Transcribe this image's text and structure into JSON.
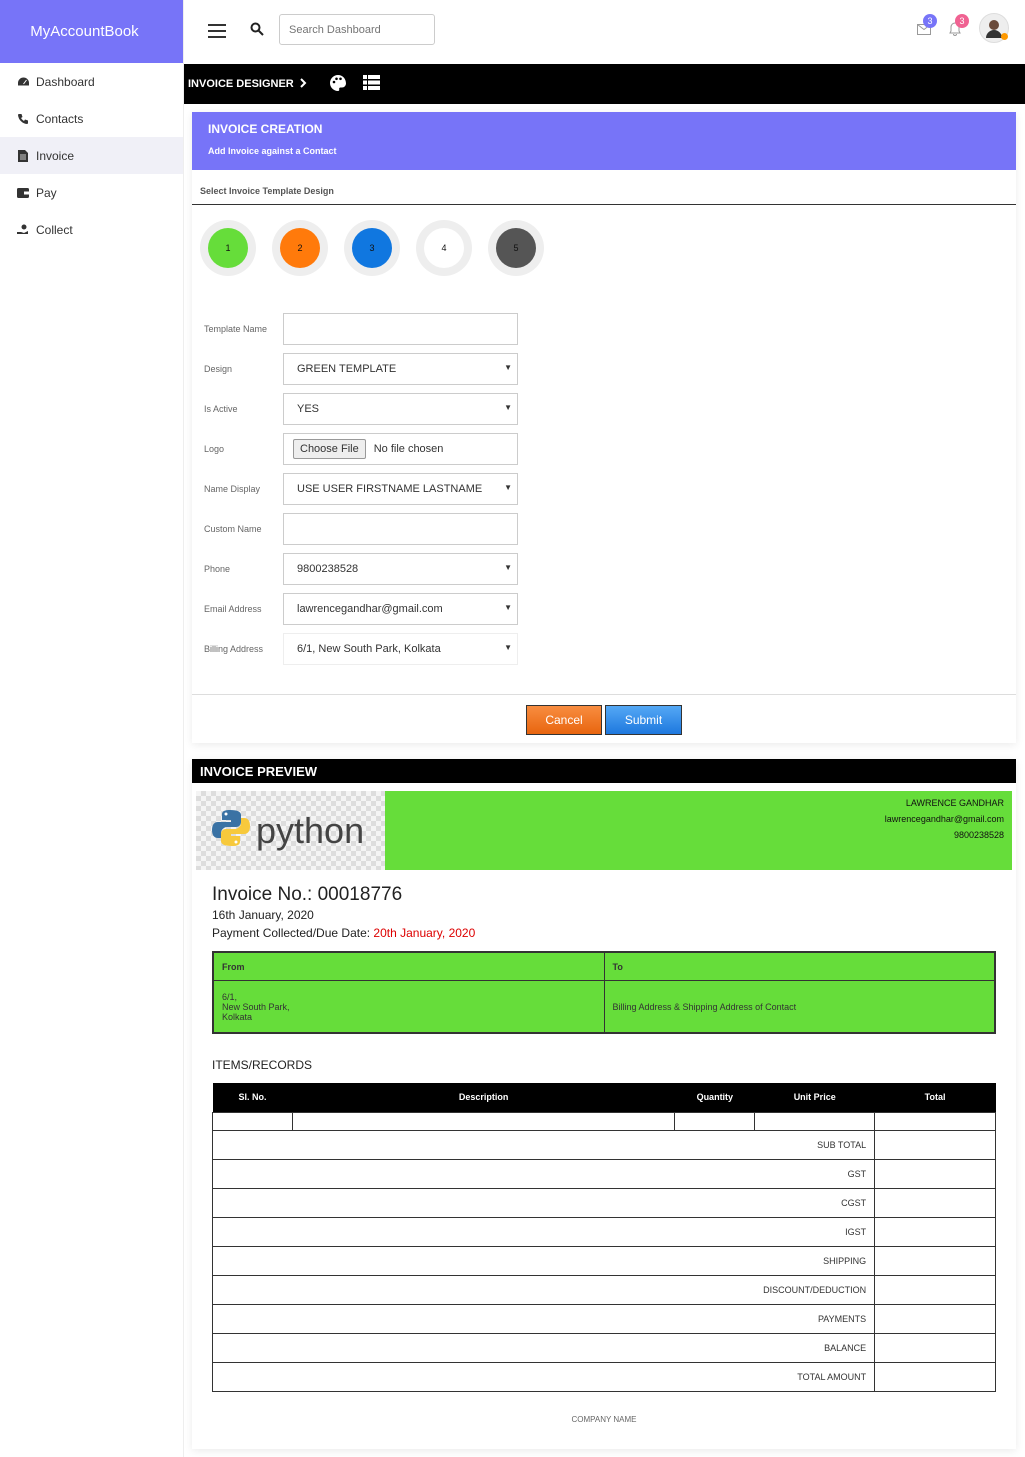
{
  "app": {
    "title": "MyAccountBook"
  },
  "sidebar": {
    "items": [
      {
        "label": "Dashboard",
        "icon": "dashboard-icon"
      },
      {
        "label": "Contacts",
        "icon": "phone-icon"
      },
      {
        "label": "Invoice",
        "icon": "document-icon"
      },
      {
        "label": "Pay",
        "icon": "wallet-icon"
      },
      {
        "label": "Collect",
        "icon": "hand-coin-icon"
      }
    ],
    "active": "Invoice"
  },
  "topbar": {
    "search_placeholder": "Search Dashboard",
    "mail_count": "3",
    "bell_count": "3",
    "mail_badge_color": "#7774f8",
    "bell_badge_color": "#f06292"
  },
  "toolbar": {
    "breadcrumb": "INVOICE DESIGNER"
  },
  "form": {
    "title": "INVOICE CREATION",
    "subtitle": "Add Invoice against a Contact",
    "template_label": "Select Invoice Template Design",
    "templates": [
      {
        "label": "1",
        "color": "#66dd3a"
      },
      {
        "label": "2",
        "color": "#ff7a0b"
      },
      {
        "label": "3",
        "color": "#1077e0"
      },
      {
        "label": "4",
        "color": "#ffffff"
      },
      {
        "label": "5",
        "color": "#555555"
      }
    ],
    "fields": {
      "template_name": {
        "label": "Template Name",
        "value": ""
      },
      "design": {
        "label": "Design",
        "value": "GREEN TEMPLATE"
      },
      "is_active": {
        "label": "Is Active",
        "value": "YES"
      },
      "logo": {
        "label": "Logo",
        "button": "Choose File",
        "value": "No file chosen"
      },
      "name_display": {
        "label": "Name Display",
        "value": "USE USER FIRSTNAME LASTNAME"
      },
      "custom_name": {
        "label": "Custom Name",
        "value": ""
      },
      "phone": {
        "label": "Phone",
        "value": "9800238528"
      },
      "email": {
        "label": "Email Address",
        "value": "lawrencegandhar@gmail.com"
      },
      "billing": {
        "label": "Billing Address",
        "value": "6/1, New South Park, Kolkata"
      }
    },
    "cancel_label": "Cancel",
    "submit_label": "Submit"
  },
  "preview": {
    "title": "INVOICE PREVIEW",
    "logo_text": "python",
    "contact_name": "LAWRENCE GANDHAR",
    "contact_email": "lawrencegandhar@gmail.com",
    "contact_phone": "9800238528",
    "invoice_no": "Invoice No.: 00018776",
    "date": "16th January, 2020",
    "due_label": "Payment Collected/Due Date: ",
    "due_date": "20th January, 2020",
    "from_label": "From",
    "to_label": "To",
    "from_line1": "6/1,",
    "from_line2": "New South Park,",
    "from_line3": "Kolkata",
    "to_value": "Billing Address & Shipping Address of Contact",
    "items_title": "ITEMS/RECORDS",
    "columns": [
      "Sl. No.",
      "Description",
      "Quantity",
      "Unit Price",
      "Total"
    ],
    "summary": [
      "SUB TOTAL",
      "GST",
      "CGST",
      "IGST",
      "SHIPPING",
      "DISCOUNT/DEDUCTION",
      "PAYMENTS",
      "BALANCE",
      "TOTAL AMOUNT"
    ],
    "company": "COMPANY NAME"
  }
}
